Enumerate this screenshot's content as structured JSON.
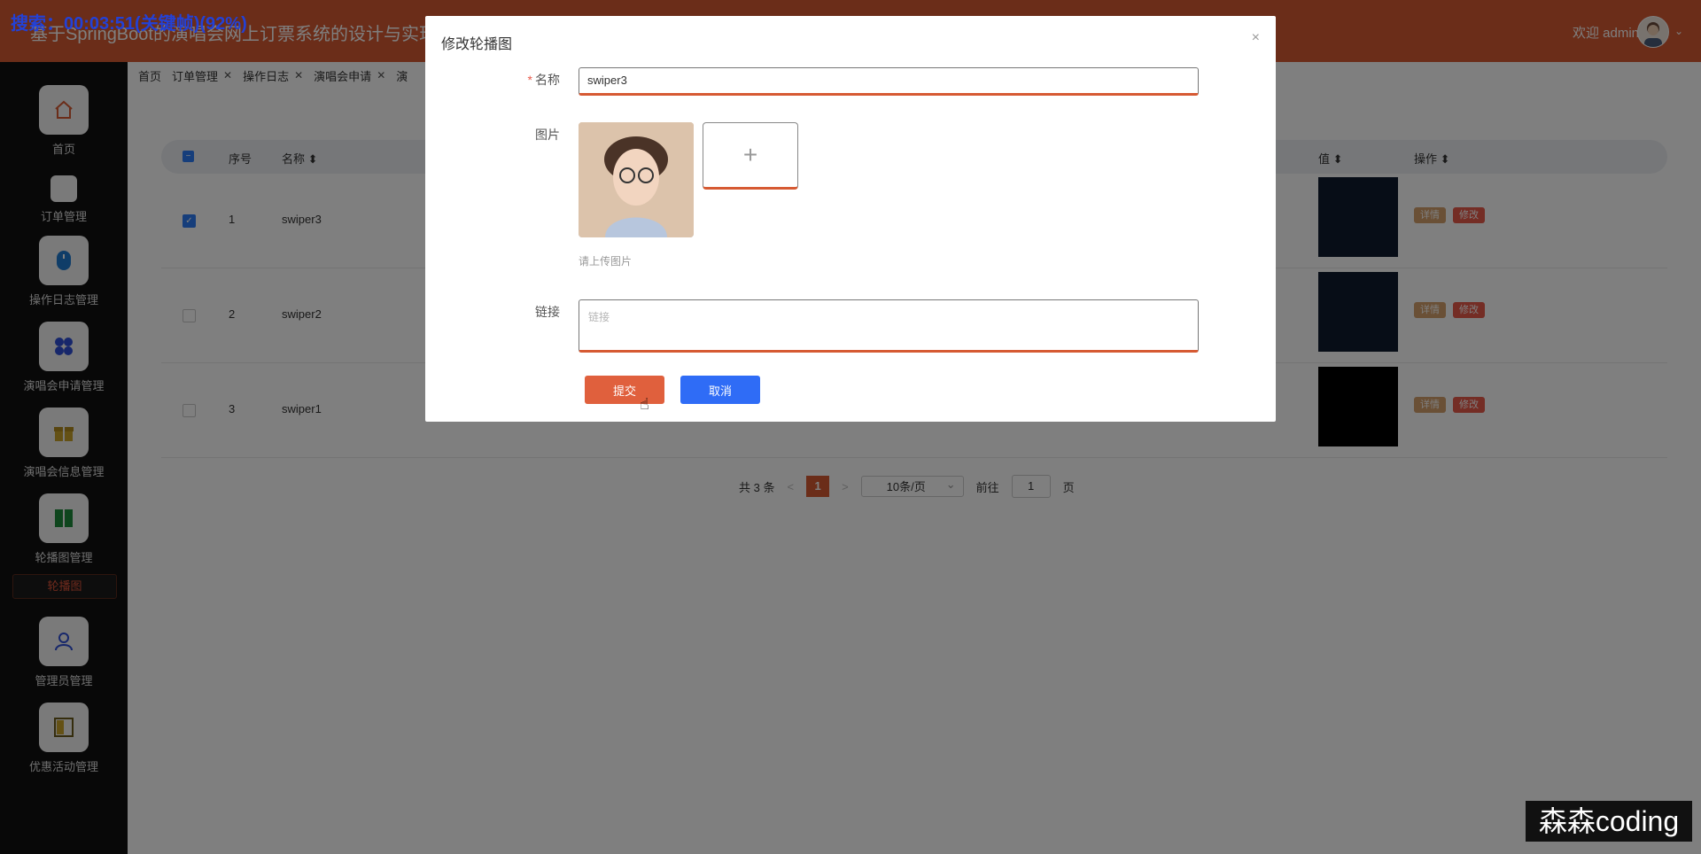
{
  "watermark": {
    "top": "搜索：00:03:51(关键帧)(92%)",
    "bottom_right": "森森coding"
  },
  "header": {
    "title": "基于SpringBoot的演唱会网上订票系统的设计与实现",
    "welcome": "欢迎 admin"
  },
  "sidebar": {
    "items": [
      {
        "label": "首页",
        "icon": "home-icon"
      },
      {
        "label": "订单管理",
        "icon": "blank-icon"
      },
      {
        "label": "操作日志管理",
        "icon": "mouse-icon"
      },
      {
        "label": "演唱会申请管理",
        "icon": "grid-icon"
      },
      {
        "label": "演唱会信息管理",
        "icon": "gift-icon"
      },
      {
        "label": "轮播图管理",
        "icon": "book-icon"
      },
      {
        "label": "管理员管理",
        "icon": "user-icon"
      },
      {
        "label": "优惠活动管理",
        "icon": "panel-icon"
      }
    ],
    "sub_item": "轮播图"
  },
  "tabs": [
    {
      "label": "首页",
      "closable": false
    },
    {
      "label": "订单管理",
      "closable": true
    },
    {
      "label": "操作日志",
      "closable": true
    },
    {
      "label": "演唱会申请",
      "closable": true
    },
    {
      "label": "演",
      "closable": false
    }
  ],
  "table": {
    "headers": {
      "index": "序号",
      "name": "名称",
      "value": "值",
      "actions": "操作"
    },
    "rows": [
      {
        "index": "1",
        "name": "swiper3",
        "checked": true,
        "thumb": "concert"
      },
      {
        "index": "2",
        "name": "swiper2",
        "checked": false,
        "thumb": "concert"
      },
      {
        "index": "3",
        "name": "swiper1",
        "checked": false,
        "thumb": "black"
      }
    ],
    "detail_label": "详情",
    "edit_label": "修改"
  },
  "pagination": {
    "total": "共 3 条",
    "prev": "<",
    "current": "1",
    "next": ">",
    "page_size": "10条/页",
    "goto_label": "前往",
    "goto_value": "1",
    "page_suffix": "页"
  },
  "dialog": {
    "title": "修改轮播图",
    "close": "×",
    "name_label": "名称",
    "name_value": "swiper3",
    "image_label": "图片",
    "upload_plus": "+",
    "image_hint": "请上传图片",
    "link_label": "链接",
    "link_placeholder": "链接",
    "submit": "提交",
    "cancel": "取消"
  },
  "colors": {
    "brand": "#d65a33",
    "primary_blue": "#2f6cf6",
    "danger": "#e95a4b",
    "warning": "#d4a06c"
  }
}
